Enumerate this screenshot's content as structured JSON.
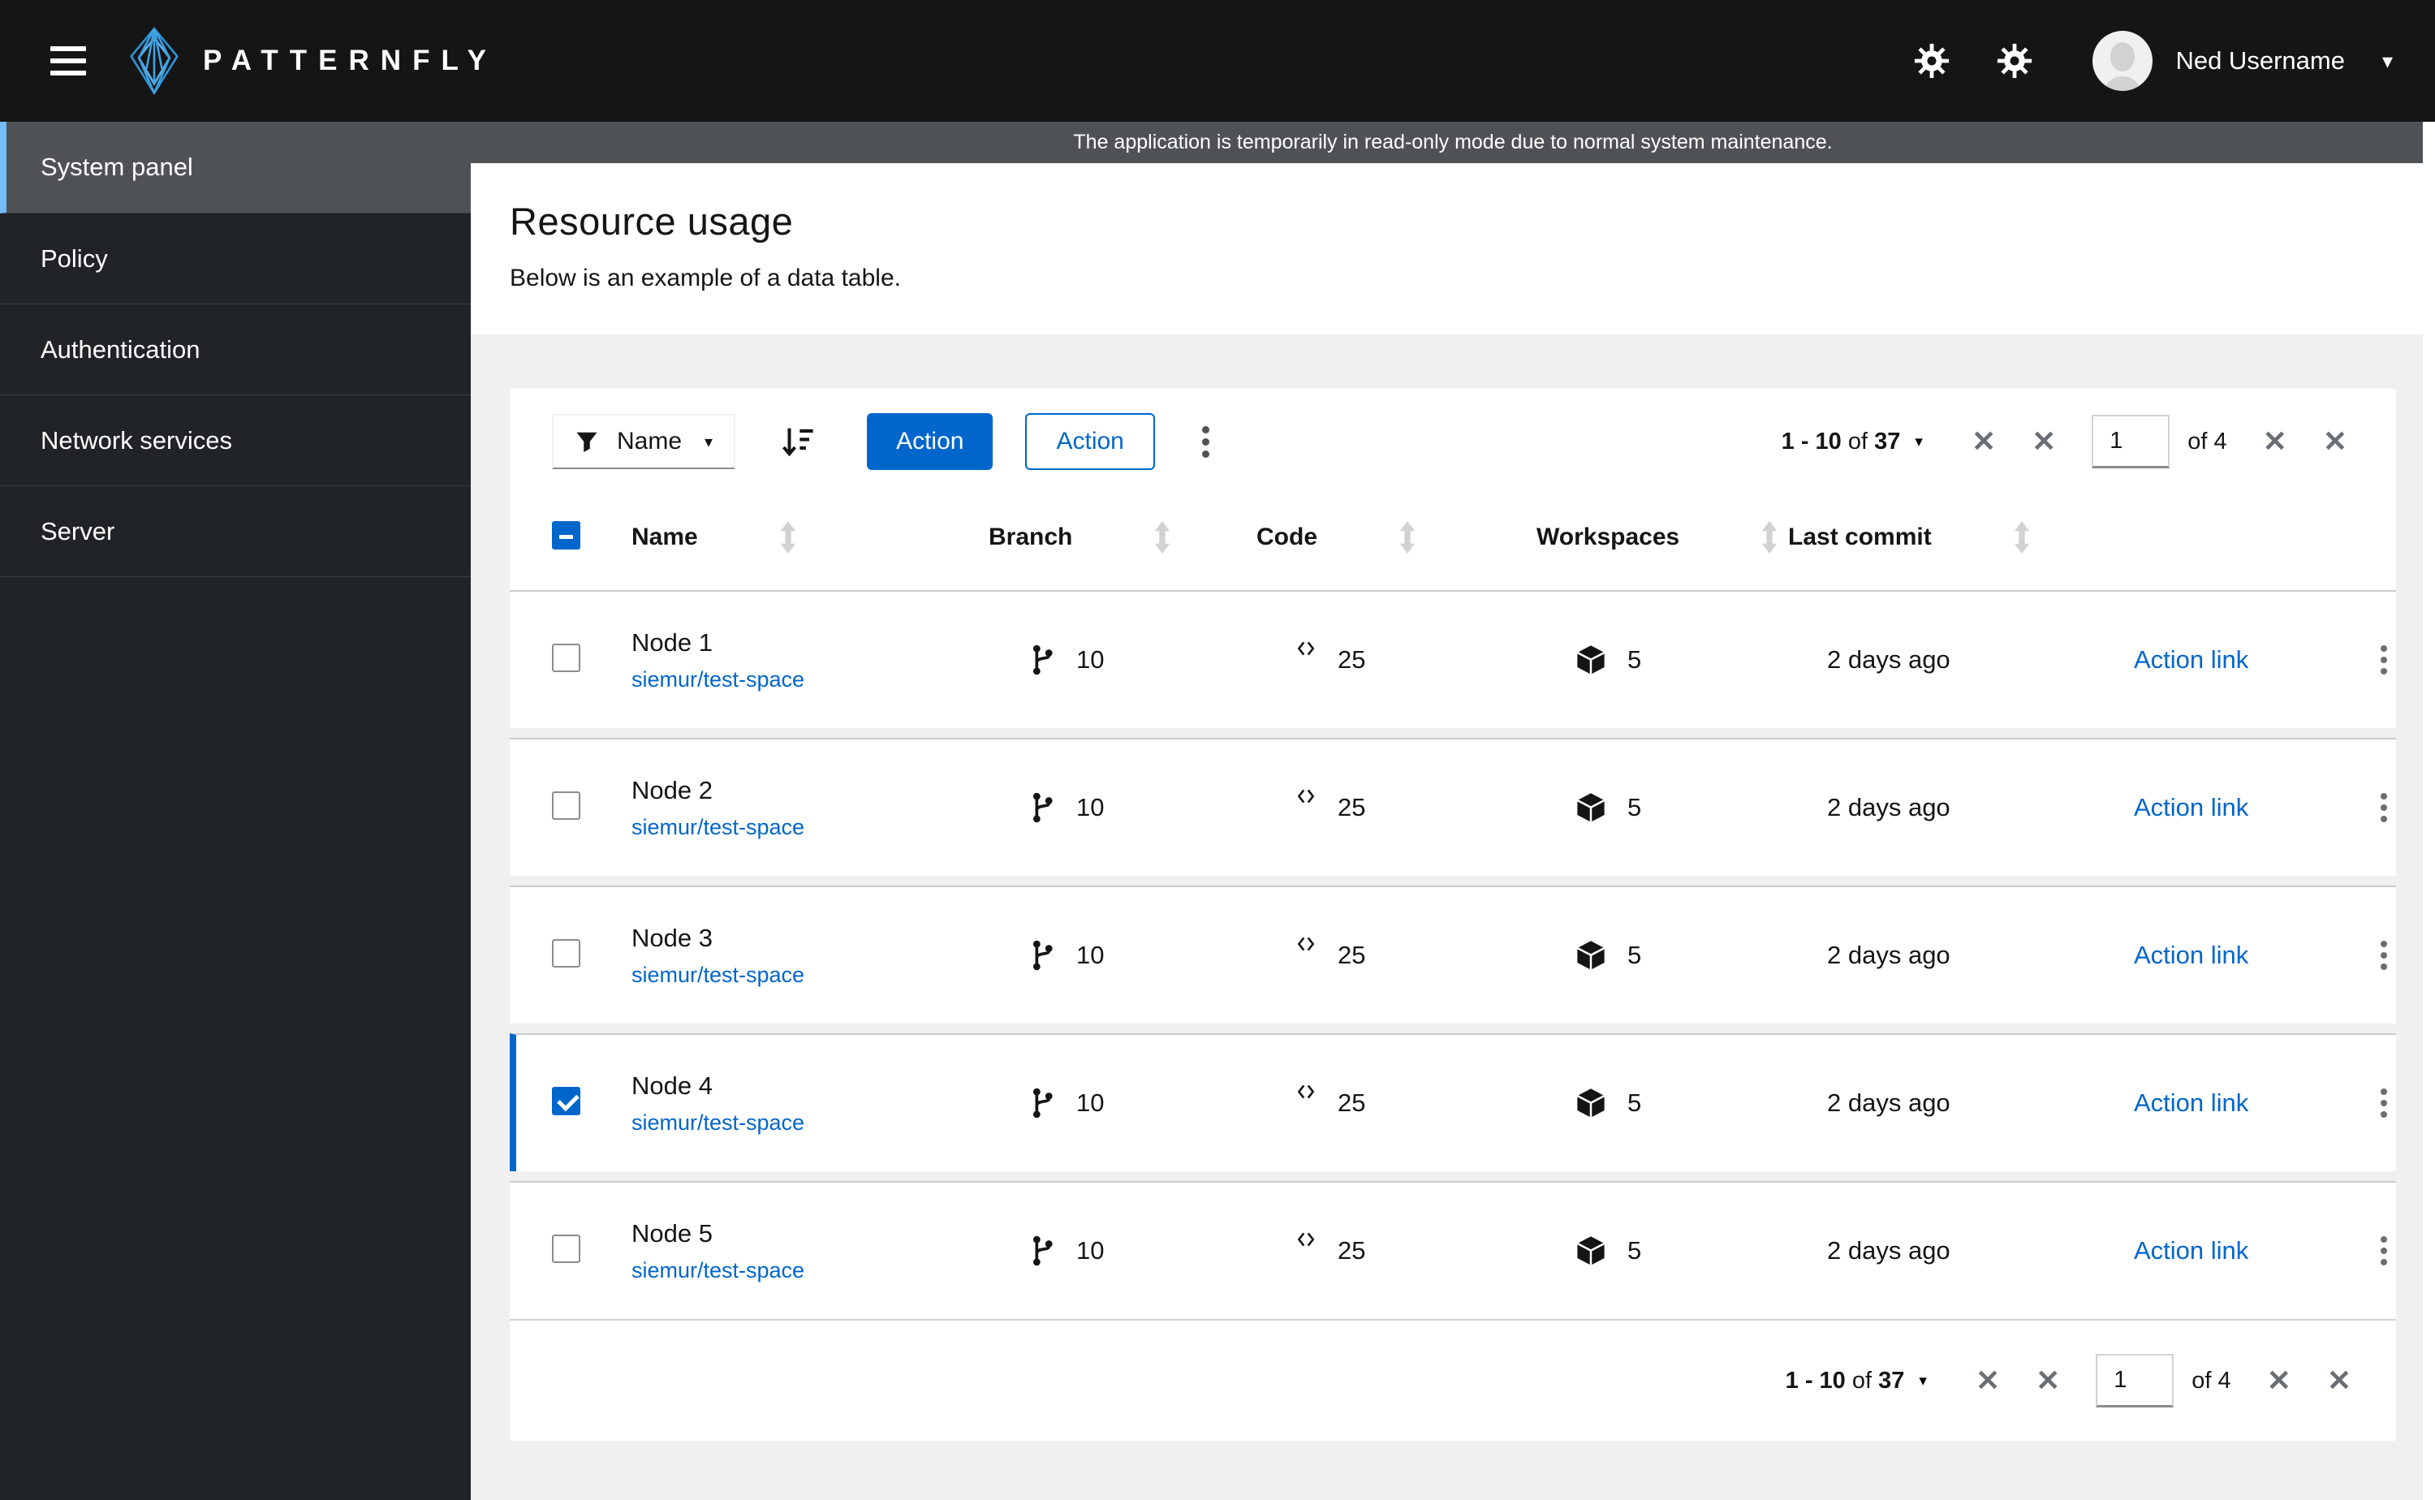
{
  "masthead": {
    "brand": "PATTERNFLY",
    "username": "Ned Username"
  },
  "banner": {
    "text": "The application is temporarily in read-only mode due to normal system maintenance."
  },
  "sidebar": {
    "items": [
      {
        "label": "System panel",
        "active": true
      },
      {
        "label": "Policy",
        "active": false
      },
      {
        "label": "Authentication",
        "active": false
      },
      {
        "label": "Network services",
        "active": false
      },
      {
        "label": "Server",
        "active": false
      }
    ]
  },
  "page": {
    "title": "Resource usage",
    "subtitle": "Below is an example of a data table."
  },
  "toolbar": {
    "filter_label": "Name",
    "primary_action": "Action",
    "secondary_action": "Action"
  },
  "pagination": {
    "range": "1 - 10",
    "of_word": "of",
    "total": "37",
    "page_input": "1",
    "pages_label": "of 4"
  },
  "table": {
    "columns": {
      "name": "Name",
      "branch": "Branch",
      "code": "Code",
      "workspaces": "Workspaces",
      "last_commit": "Last commit"
    },
    "rows": [
      {
        "name": "Node 1",
        "link": "siemur/test-space",
        "branch": "10",
        "code": "25",
        "workspaces": "5",
        "last_commit": "2 days ago",
        "action": "Action link",
        "selected": false
      },
      {
        "name": "Node 2",
        "link": "siemur/test-space",
        "branch": "10",
        "code": "25",
        "workspaces": "5",
        "last_commit": "2 days ago",
        "action": "Action link",
        "selected": false
      },
      {
        "name": "Node 3",
        "link": "siemur/test-space",
        "branch": "10",
        "code": "25",
        "workspaces": "5",
        "last_commit": "2 days ago",
        "action": "Action link",
        "selected": false
      },
      {
        "name": "Node 4",
        "link": "siemur/test-space",
        "branch": "10",
        "code": "25",
        "workspaces": "5",
        "last_commit": "2 days ago",
        "action": "Action link",
        "selected": true
      },
      {
        "name": "Node 5",
        "link": "siemur/test-space",
        "branch": "10",
        "code": "25",
        "workspaces": "5",
        "last_commit": "2 days ago",
        "action": "Action link",
        "selected": false
      }
    ]
  },
  "colors": {
    "primary_blue": "#0066cc",
    "masthead_bg": "#151515",
    "sidebar_bg": "#212427",
    "active_nav_bg": "#4f5255",
    "active_nav_border": "#73bcf7",
    "banner_bg": "#4f5255",
    "page_bg": "#f0f0f0"
  }
}
